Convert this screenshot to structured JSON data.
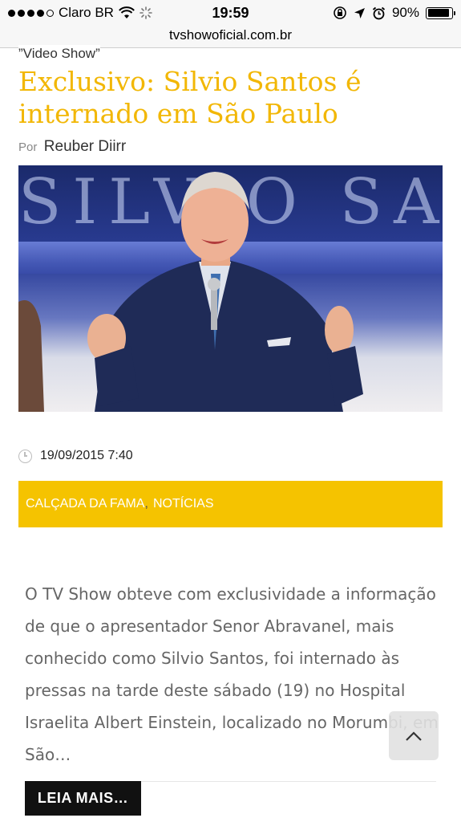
{
  "status_bar": {
    "carrier": "Claro BR",
    "time": "19:59",
    "battery": "90%",
    "battery_level": 0.9
  },
  "browser": {
    "url": "tvshowoficial.com.br"
  },
  "article": {
    "kicker": "”Video Show”",
    "title": "Exclusivo: Silvio Santos é internado em São Paulo",
    "by_label": "Por",
    "author": "Reuber Diirr",
    "hero_backdrop_text": "SILVIO SA",
    "date": "19/09/2015 7:40",
    "categories": [
      "CALÇADA DA FAMA",
      "NOTÍCIAS"
    ],
    "category_separator": ",",
    "excerpt": "O TV Show obteve com exclusividade a informação de que o apresentador Senor Abravanel, mais conhecido como Silvio Santos, foi internado às pressas na tarde deste sábado (19) no Hospital Israelita Albert Einstein, localizado no Morumbi, em São…",
    "read_more": "LEIA MAIS…"
  },
  "colors": {
    "accent": "#f5c300",
    "title": "#f2b705"
  },
  "icons": {
    "clock": "clock-icon",
    "scroll_top": "chevron-up-icon"
  }
}
